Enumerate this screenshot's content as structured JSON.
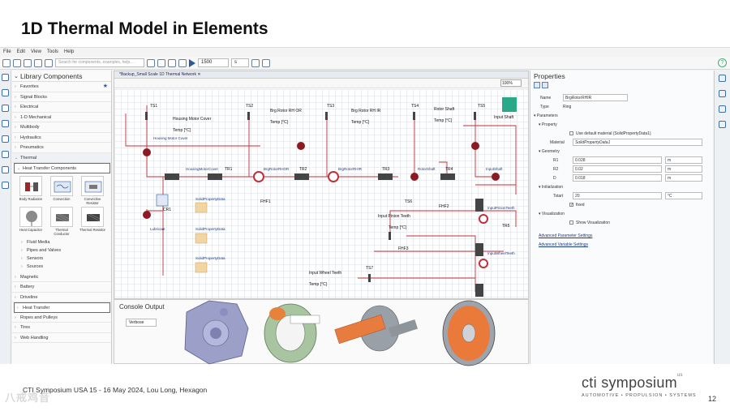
{
  "slide": {
    "title": "1D Thermal Model in Elements",
    "footer": "CTI Symposium USA 15 - 16 May 2024, Lou Long, Hexagon",
    "page": "12",
    "watermark": "八戒鸡音",
    "logo": "cti symposium",
    "logo_sup": "us",
    "tagline": "AUTOMOTIVE • PROPULSION • SYSTEMS"
  },
  "menu": [
    "File",
    "Edit",
    "View",
    "Tools",
    "Help"
  ],
  "toolbar": {
    "search_placeholder": "Search for components, examples, help...",
    "sim_time": "1500",
    "sim_unit": "s"
  },
  "library": {
    "title": "Library Components",
    "items": [
      "Favorites",
      "Signal Blocks",
      "Electrical",
      "1-D Mechanical",
      "Multibody",
      "Hydraulics",
      "Pneumatics",
      "Thermal"
    ],
    "open_item": "Heat Transfer Components",
    "components": [
      "Body Radiation",
      "Convection",
      "Convective Resistor",
      "Heat Capacitor",
      "Thermal Conductor",
      "Thermal Resistor"
    ],
    "subitems": [
      "Fluid Media",
      "Pipes and Valves",
      "Sensors",
      "Sources"
    ],
    "more_items": [
      "Magnetic",
      "Battery",
      "Driveline",
      "Heat Transfer",
      "Ropes and Pulleys",
      "Tires",
      "Web Handling"
    ]
  },
  "diagram": {
    "tab": "*Backup_Small Scale 1D Thermal Network",
    "zoom": "100%",
    "labels": {
      "housing_cover": "Housing Motor Cover",
      "housing_cover_b": "Housing Motor Cover",
      "brg_rotor_hr_or": "Brg Rotor RH OR",
      "brg_rotor_rh_ir": "Brg Rotor RH IR",
      "rotor_shaft": "Rotor Shaft",
      "input_shaft": "Input Shaft",
      "temp": "Temp [°C]",
      "housing_cond": "HousingMotorCover",
      "brg_rhor": "BrgRotorRHOR",
      "brg_rhir": "BrgRotorRHIR",
      "rotor_shaft2": "RotorShaft",
      "input_shaft2": "InputShaft",
      "solid1": "SolidPropertyData",
      "solid2": "SolidPropertyData",
      "solid3": "SolidPropertyData",
      "lubricant": "Lubricant",
      "input_pinion": "Input Pinion Teeth",
      "input_pinion2": "InputPinionTeeth",
      "input_wheel": "Input Wheel Teeth",
      "input_wheel2": "InputWheelTeeth",
      "ts1": "TS1",
      "ts2": "TS2",
      "ts3": "TS3",
      "ts4": "TS4",
      "ts5": "TS5",
      "ts6": "TS6",
      "ts7": "TS7",
      "tr1": "TR1",
      "tr2": "TR2",
      "tr3": "TR3",
      "tr4": "TR4",
      "tr5": "TR5",
      "cr1": "CR1",
      "fhf1": "FHF1",
      "fhf2": "FHF2",
      "fhf3": "FHF3"
    }
  },
  "console": {
    "title": "Console Output",
    "level": "Verbose"
  },
  "properties": {
    "title": "Properties",
    "name_label": "Name",
    "name_value": "BrgRotorRHIR",
    "type_label": "Type",
    "type_value": "Ring",
    "parameters": "Parameters",
    "property": "Property",
    "use_default": "Use default material (SolidPropertyData1)",
    "material_label": "Material",
    "material_value": "SolidPropertyData1",
    "geometry": "Geometry",
    "r1_label": "R1",
    "r1_value": "0.028",
    "r1_unit": "m",
    "r2_label": "R2",
    "r2_value": "0.02",
    "r2_unit": "m",
    "d_label": "D",
    "d_value": "0.018",
    "d_unit": "m",
    "initialization": "Initialization",
    "tstart_label": "Tstart",
    "tstart_value": "20",
    "tstart_unit": "°C",
    "fixed": "fixed",
    "visualization": "Visualization",
    "show_vis": "Show Visualization",
    "adv_params": "Advanced Parameter Settings",
    "adv_vars": "Advanced Variable Settings"
  },
  "colors": {
    "accent": "#2a5a9a",
    "highlight": "#d24040",
    "wire": "#c0303a",
    "node": "#8b1a22"
  }
}
